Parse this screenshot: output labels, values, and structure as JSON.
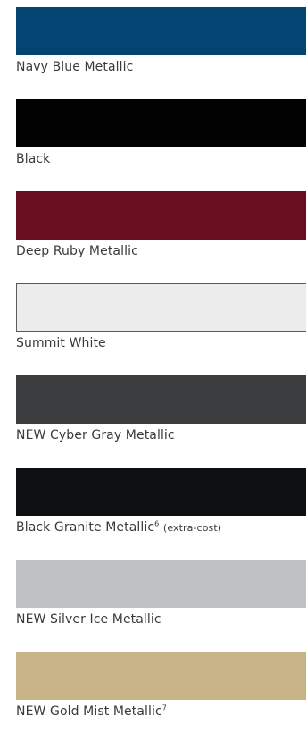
{
  "colors": [
    {
      "name": "Navy Blue Metallic",
      "sup": "",
      "note": "",
      "swatch": "#034472",
      "outlined": false
    },
    {
      "name": "Black",
      "sup": "",
      "note": "",
      "swatch": "#020202",
      "outlined": false
    },
    {
      "name": "Deep Ruby Metallic",
      "sup": "",
      "note": "",
      "swatch": "#6a0f22",
      "outlined": false
    },
    {
      "name": "Summit White",
      "sup": "",
      "note": "",
      "swatch": "#ececec",
      "outlined": true
    },
    {
      "name": "NEW Cyber Gray Metallic",
      "sup": "",
      "note": "",
      "swatch": "#3b3d3f",
      "outlined": false
    },
    {
      "name": "Black Granite Metallic",
      "sup": "6",
      "note": "(extra-cost)",
      "swatch": "#0d0f12",
      "outlined": false
    },
    {
      "name": "NEW Silver Ice Metallic",
      "sup": "",
      "note": "",
      "swatch": "#bfc1c4",
      "outlined": false
    },
    {
      "name": "NEW Gold Mist Metallic",
      "sup": "7",
      "note": "",
      "swatch": "#c8b587",
      "outlined": false
    }
  ]
}
